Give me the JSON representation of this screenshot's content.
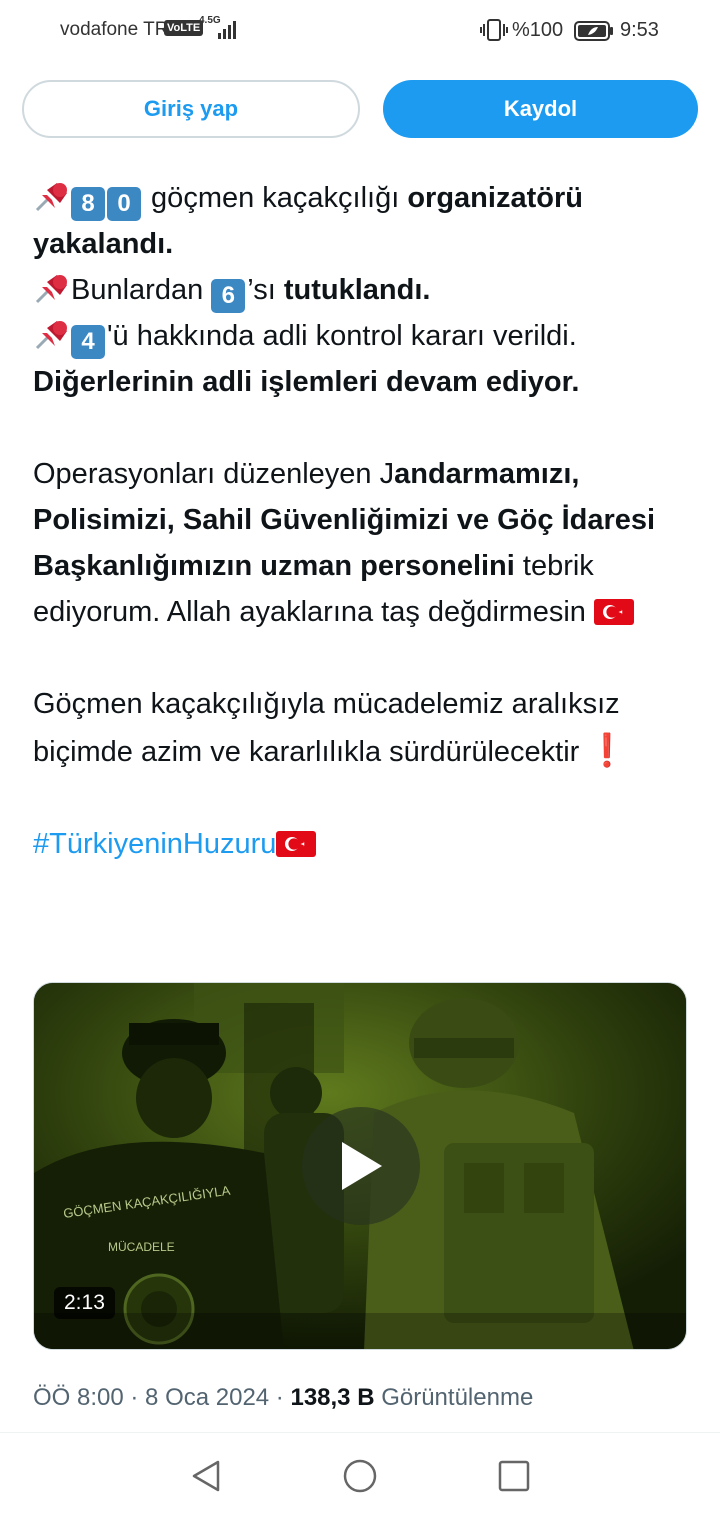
{
  "status_bar": {
    "carrier": "vodafone TR",
    "volte": "VoLTE",
    "network": "4.5G",
    "battery_percent": "%100",
    "time": "9:53"
  },
  "auth": {
    "login_label": "Giriş yap",
    "signup_label": "Kaydol"
  },
  "tweet": {
    "line1_num1": "8",
    "line1_num2": "0",
    "line1_text": " göçmen kaçakçılığı ",
    "line1_bold": "organizatörü yakalandı.",
    "line2_text": "Bunlardan ",
    "line2_num": "6",
    "line2_suffix": "’sı ",
    "line2_bold": "tutuklandı.",
    "line3_num": "4",
    "line3_text": "'ü hakkında adli kontrol kararı verildi.",
    "line4_bold": "Diğerlerinin adli işlemleri devam ediyor.",
    "para2_prefix": "Operasyonları düzenleyen J",
    "para2_bold": "andarmamızı, Polisimizi, Sahil Güvenliğimizi ve Göç İdaresi Başkanlığımızın uzman personelini",
    "para2_suffix": " tebrik ediyorum. Allah ayaklarına taş değdirmesin ",
    "para3_text": "Göçmen kaçakçılığıyla mücadelemiz aralıksız biçimde azim ve kararlılıkla sürdürülecektir ",
    "para3_emoji": "❗",
    "hashtag": "#TürkiyeninHuzuru"
  },
  "video": {
    "duration": "2:13",
    "jacket_text_line1": "GÖÇMEN KAÇAKÇILIĞIYLA",
    "jacket_text_line2": "MÜCADELE"
  },
  "meta": {
    "time": "ÖÖ 8:00",
    "sep1": " · ",
    "date": "8 Oca 2024",
    "sep2": " · ",
    "views_count": "138,3 B",
    "views_label": " Görüntülenme"
  },
  "colors": {
    "accent": "#1d9bf0",
    "text": "#0f1419",
    "muted": "#536471",
    "keycap": "#3b88c3",
    "flag_red": "#e30a17"
  },
  "icons": [
    "pushpin-icon",
    "keycap-icon",
    "turkey-flag-icon",
    "play-icon",
    "back-icon",
    "home-icon",
    "recent-apps-icon"
  ]
}
